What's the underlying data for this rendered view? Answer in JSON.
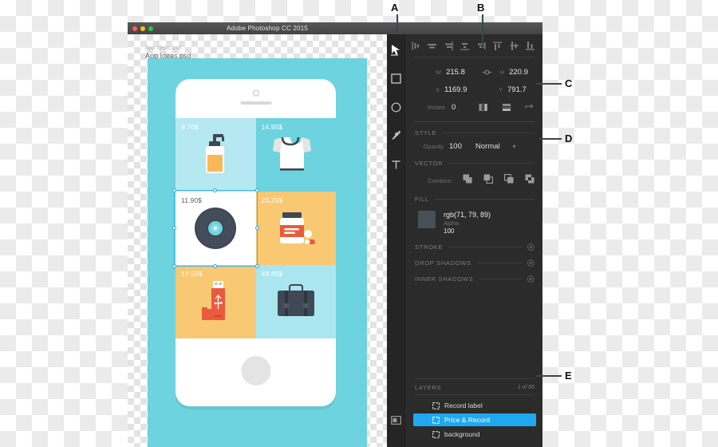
{
  "window": {
    "title": "Adobe Photoshop CC 2015",
    "traffic_lights": [
      "close-red",
      "minimize-yellow",
      "maximize-green"
    ]
  },
  "document": {
    "tab_label": "App Ideas.psd",
    "tab_ghost_label": "App Ideas.psd",
    "artboard_bg": "#6dd3de"
  },
  "mockup": {
    "device": "iphone",
    "products": [
      {
        "price": "9.70$",
        "item": "soap-dispenser",
        "bg": "#b5e8f0",
        "cell_style": "light-cell"
      },
      {
        "price": "14.95$",
        "item": "t-shirt",
        "bg": "#6dd3de",
        "cell_style": "light-cell"
      },
      {
        "price": "11.90$",
        "item": "vinyl-record",
        "bg": "#ffffff",
        "cell_style": "white-cell",
        "selected": true
      },
      {
        "price": "23.25$",
        "item": "pill-bottle",
        "bg": "#f9c873",
        "cell_style": "light-cell"
      },
      {
        "price": "17.55$",
        "item": "usb-flash-drive",
        "bg": "#f9c873",
        "cell_style": "light-cell"
      },
      {
        "price": "49.85$",
        "item": "briefcase",
        "bg": "#aae6f0",
        "cell_style": "light-cell"
      }
    ]
  },
  "toolbar": {
    "tools": [
      {
        "name": "move-tool",
        "icon": "pointer-icon",
        "selected": true
      },
      {
        "name": "rectangle-tool",
        "icon": "rectangle-icon",
        "selected": false
      },
      {
        "name": "ellipse-tool",
        "icon": "ellipse-icon",
        "selected": false
      },
      {
        "name": "pen-tool",
        "icon": "pen-icon",
        "selected": false
      },
      {
        "name": "text-tool",
        "icon": "text-icon",
        "selected": false
      }
    ],
    "bottom_tool": {
      "name": "artboard-tool",
      "icon": "artboard-icon"
    }
  },
  "align_bar": {
    "buttons": [
      "align-left-icon",
      "align-center-horizontal-icon",
      "align-right-icon",
      "distribute-horizontal-icon",
      "align-edges-icon",
      "align-top-icon",
      "align-middle-vertical-icon",
      "align-bottom-icon"
    ]
  },
  "transform": {
    "w_label": "W",
    "w_value": "215.8",
    "link_icon": "link-proportions-icon",
    "h_label": "H",
    "h_value": "220.9",
    "x_label": "X",
    "x_value": "1169.9",
    "y_label": "Y",
    "y_value": "791.7",
    "rotate_label": "Rotate",
    "rotate_value": "0",
    "flip_horizontal_icon": "flip-horizontal-icon",
    "flip_vertical_icon": "flip-vertical-icon",
    "reset_icon": "reset-transform-icon"
  },
  "style": {
    "title": "STYLE",
    "opacity_label": "Opacity",
    "opacity_value": "100",
    "blend_mode": "Normal",
    "chevron": "chevron-down-icon"
  },
  "vector": {
    "title": "VECTOR",
    "combine_label": "Combine",
    "operations": [
      "combine-union-icon",
      "combine-subtract-icon",
      "combine-intersect-icon",
      "combine-exclude-icon"
    ]
  },
  "fill": {
    "title": "FILL",
    "color_hex": "#474f59",
    "color_text": "rgb(71, 79, 89)",
    "alpha_label": "Alpha",
    "alpha_value": "100"
  },
  "stroke": {
    "title": "STROKE",
    "add": "+"
  },
  "drop_shadows": {
    "title": "DROP SHADOWS",
    "add": "+"
  },
  "inner_shadows": {
    "title": "INNER SHADOWS",
    "add": "+"
  },
  "layers": {
    "title": "LAYERS",
    "count_text": "1 of 85",
    "items": [
      {
        "label": "Record label",
        "icon": "layer-shape-icon",
        "active": false
      },
      {
        "label": "Price & Record",
        "icon": "layer-shape-icon",
        "active": true
      },
      {
        "label": "background",
        "icon": "layer-shape-icon",
        "active": false
      }
    ],
    "active_color": "#1fa8f0"
  },
  "callouts": [
    {
      "label": "A"
    },
    {
      "label": "B"
    },
    {
      "label": "C"
    },
    {
      "label": "D"
    },
    {
      "label": "E"
    }
  ]
}
